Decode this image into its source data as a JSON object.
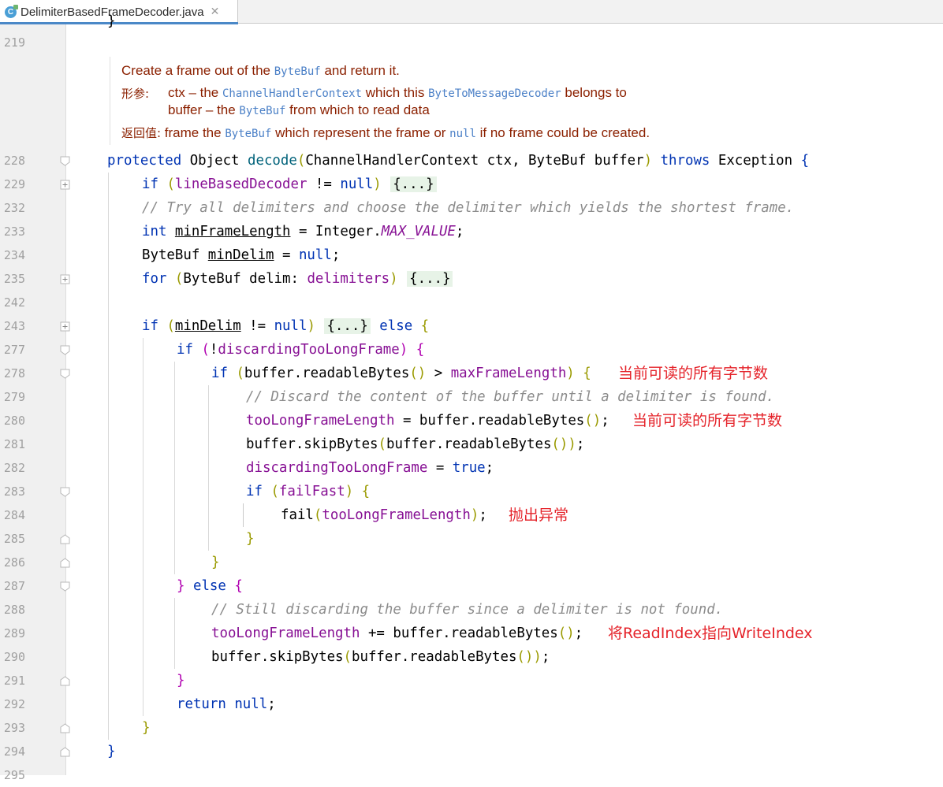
{
  "tab": {
    "title": "DelimiterBasedFrameDecoder.java",
    "icon_letter": "C"
  },
  "doc": {
    "summary_a": "Create a frame out of the ",
    "summary_code": "ByteBuf",
    "summary_b": " and return it.",
    "params_tag": "形参:",
    "p1_a": "ctx – the ",
    "p1_code1": "ChannelHandlerContext",
    "p1_b": " which this ",
    "p1_code2": "ByteToMessageDecoder",
    "p1_c": " belongs to",
    "p2_a": "buffer – the ",
    "p2_code": "ByteBuf",
    "p2_b": " from which to read data",
    "returns_tag": "返回值:",
    "r_a": " frame the ",
    "r_code1": "ByteBuf",
    "r_b": " which represent the frame or ",
    "r_code2": "null",
    "r_c": " if no frame could be created."
  },
  "lines": [
    "219",
    "228",
    "229",
    "232",
    "233",
    "234",
    "235",
    "242",
    "243",
    "277",
    "278",
    "279",
    "280",
    "281",
    "282",
    "283",
    "284",
    "285",
    "286",
    "287",
    "288",
    "289",
    "290",
    "291",
    "292",
    "293",
    "294",
    "295"
  ],
  "annotations": {
    "a278": "当前可读的所有字节数",
    "a280": "当前可读的所有字节数",
    "a284": "抛出异常",
    "a289": "将ReadIndex指向WriteIndex"
  }
}
